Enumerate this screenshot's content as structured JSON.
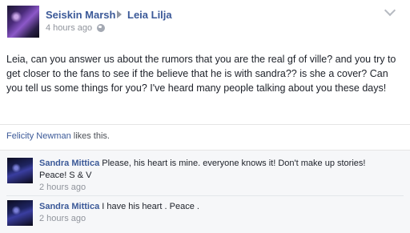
{
  "post": {
    "author": "Seiskin Marsh",
    "target": "Leia Lilja",
    "time": "4 hours ago",
    "separator": "·",
    "text": "Leia, can you answer us about the rumors that you are the real gf of ville? and you try to get closer to the fans to see if the believe that he is with sandra?? is she a cover? Can you tell us some things for you? I've heard many people talking about you these days!"
  },
  "likes": {
    "name": "Felicity Newman",
    "suffix": " likes this."
  },
  "comments": [
    {
      "author": "Sandra Mittica",
      "text": "Please, his heart is mine. everyone knows it! Don't make up stories! Peace! S & V",
      "time": "2 hours ago"
    },
    {
      "author": "Sandra Mittica",
      "text": "I have his heart . Peace .",
      "time": "2 hours ago"
    }
  ],
  "icons": {
    "arrow": "right-triangle",
    "privacy": "globe",
    "menu": "chevron-down"
  },
  "colors": {
    "link": "#3b5998",
    "meta": "#90949c",
    "comments_bg": "#f6f7f9"
  }
}
